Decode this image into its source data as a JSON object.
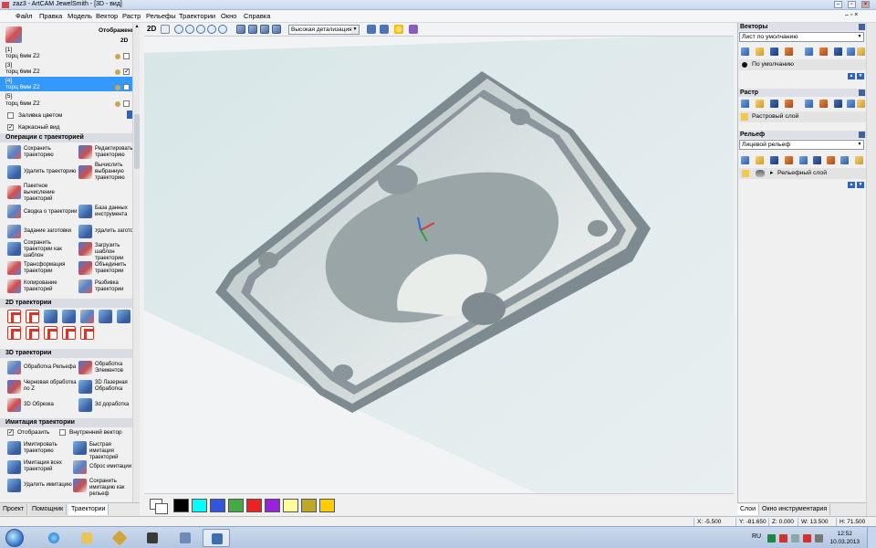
{
  "window": {
    "title": "zaz3 - ArtCAM JewelSmith - [3D - вид]",
    "minimize": "–",
    "restore": "▫",
    "close": "×"
  },
  "menu": [
    "Файл",
    "Правка",
    "Модель",
    "Вектор",
    "Растр",
    "Рельефы",
    "Траектории",
    "Окно",
    "Справка"
  ],
  "left_panel": {
    "display_label": "Отображение",
    "display_mode": "2D",
    "toolpaths": [
      {
        "index": "[1]",
        "name": "торц 6мм Z2",
        "selected": false,
        "visible": false
      },
      {
        "index": "[3]",
        "name": "торц 6мм Z2",
        "selected": false,
        "visible": true
      },
      {
        "index": "[4]",
        "name": "торц 6мм Z2",
        "selected": true,
        "visible": false
      },
      {
        "index": "[5]",
        "name": "торц 6мм Z2",
        "selected": false,
        "visible": false
      }
    ],
    "fill_color_label": "Заливка цветом",
    "wireframe_label": "Каркасный вид",
    "section_ops": "Операции с траекторией",
    "ops": [
      "Сохранить траекторию",
      "Редактировать траекторию",
      "Удалить траекторию",
      "Вычислить выбранную траекторию",
      "Пакетное вычисление траекторий",
      "Сводка о траектории",
      "База данных инструмента",
      "Задание заготовки",
      "Удалить заготовку",
      "Сохранить траектории как шаблон",
      "Загрузить шаблон траектории",
      "Трансформация траектории",
      "Объединить траектории",
      "Копирование траекторий",
      "Разбивка траектории"
    ],
    "section_2d": "2D траектории",
    "section_3d": "3D траектории",
    "ops3d": [
      "Обработка Рельефа",
      "Обработка Элементов",
      "Черновая обработка по Z",
      "3D Лазерная Обработка",
      "3D Обрезка",
      "3d доработка"
    ],
    "section_sim": "Имитация траектории",
    "show_label": "Отобразить",
    "inner_vector_label": "Внутренний вектор",
    "sim_ops": [
      "Имитировать траекторию",
      "Быстрая имитация траекторий",
      "Имитация всех траекторий",
      "Сброс имитации",
      "Удалить имитацию",
      "Сохранить имитацию как рельеф"
    ],
    "tabs": [
      "Проект",
      "Помощник",
      "Траектории"
    ]
  },
  "view_toolbar": {
    "mode": "2D",
    "detail_level": "Высокая детализация"
  },
  "palette": {
    "colors": [
      "#000000",
      "#00ffff",
      "#3355dd",
      "#44aa44",
      "#ee2222",
      "#9922dd",
      "#ffff99",
      "#bbaa22",
      "#ffcc00"
    ]
  },
  "right_panel": {
    "vectors_title": "Векторы",
    "vectors_sheet": "Лист по умолчанию",
    "vectors_layer": "По умолчанию",
    "raster_title": "Растр",
    "raster_layer": "Растровый слой",
    "relief_title": "Рельеф",
    "relief_type": "Лицевой рельеф",
    "relief_layer": "Рельефный слой",
    "tabs": [
      "Слои",
      "Окно инструментария"
    ]
  },
  "status": {
    "x": "X: -5.500",
    "y": "Y: -81.650",
    "z": "Z: 0.000",
    "w": "W: 13.500",
    "h": "H: 71.500"
  },
  "taskbar": {
    "lang": "RU",
    "time": "12:52",
    "date": "10.03.2013"
  }
}
